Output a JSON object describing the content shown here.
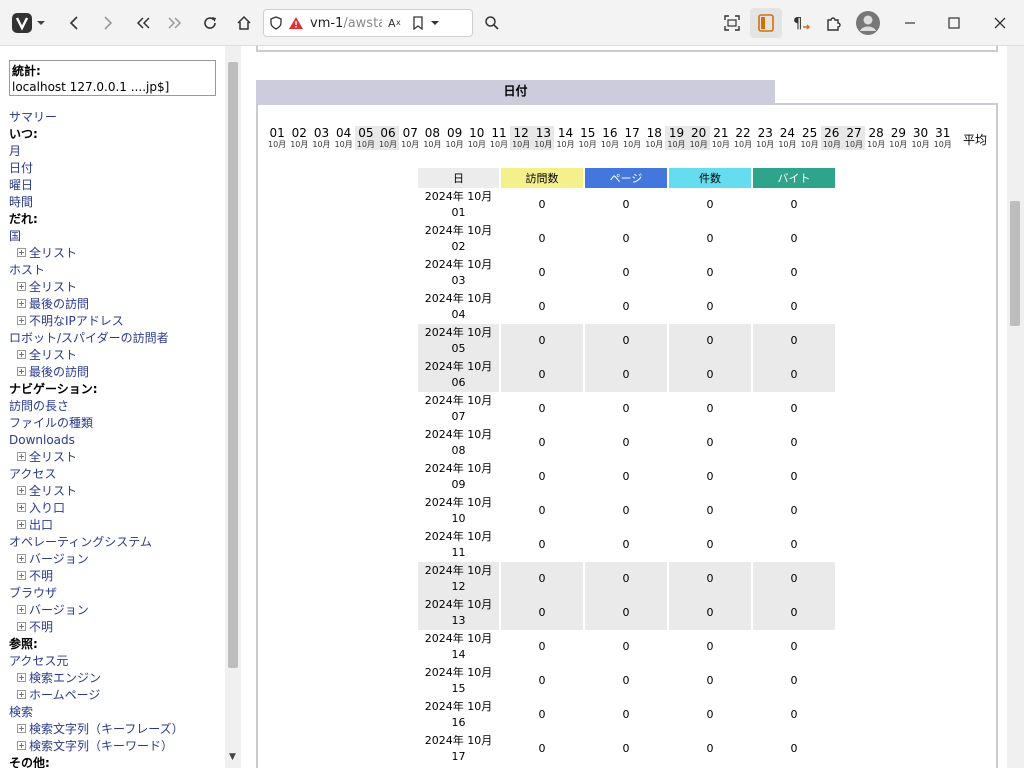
{
  "browser": {
    "url_host": "vm-1",
    "url_path": "/awstats/av"
  },
  "sidebar": {
    "stat_label": "統計:",
    "stat_value": "localhost 127.0.0.1 ....jp$]",
    "items": [
      {
        "type": "l",
        "label": "サマリー"
      },
      {
        "type": "h",
        "label": "いつ:"
      },
      {
        "type": "l",
        "label": "月"
      },
      {
        "type": "l",
        "label": "日付"
      },
      {
        "type": "l",
        "label": "曜日"
      },
      {
        "type": "l",
        "label": "時間"
      },
      {
        "type": "h",
        "label": "だれ:"
      },
      {
        "type": "l",
        "label": "国"
      },
      {
        "type": "s",
        "label": "全リスト"
      },
      {
        "type": "l",
        "label": "ホスト"
      },
      {
        "type": "s",
        "label": "全リスト"
      },
      {
        "type": "s",
        "label": "最後の訪問"
      },
      {
        "type": "s",
        "label": "不明なIPアドレス"
      },
      {
        "type": "l",
        "label": "ロボット/スパイダーの訪問者"
      },
      {
        "type": "s",
        "label": "全リスト"
      },
      {
        "type": "s",
        "label": "最後の訪問"
      },
      {
        "type": "h",
        "label": "ナビゲーション:"
      },
      {
        "type": "l",
        "label": "訪問の長さ"
      },
      {
        "type": "l",
        "label": "ファイルの種類"
      },
      {
        "type": "l",
        "label": "Downloads"
      },
      {
        "type": "s",
        "label": "全リスト"
      },
      {
        "type": "l",
        "label": "アクセス"
      },
      {
        "type": "s",
        "label": "全リスト"
      },
      {
        "type": "s",
        "label": "入り口"
      },
      {
        "type": "s",
        "label": "出口"
      },
      {
        "type": "l",
        "label": "オペレーティングシステム"
      },
      {
        "type": "s",
        "label": "バージョン"
      },
      {
        "type": "s",
        "label": "不明"
      },
      {
        "type": "l",
        "label": "ブラウザ"
      },
      {
        "type": "s",
        "label": "バージョン"
      },
      {
        "type": "s",
        "label": "不明"
      },
      {
        "type": "h",
        "label": "参照:"
      },
      {
        "type": "l",
        "label": "アクセス元"
      },
      {
        "type": "s",
        "label": "検索エンジン"
      },
      {
        "type": "s",
        "label": "ホームページ"
      },
      {
        "type": "l",
        "label": "検索"
      },
      {
        "type": "s",
        "label": "検索文字列（キーフレーズ）"
      },
      {
        "type": "s",
        "label": "検索文字列（キーワード）"
      },
      {
        "type": "h",
        "label": "その他:"
      }
    ]
  },
  "main": {
    "section_title": "日付",
    "month_label": "10月",
    "avg_label": "平均",
    "days": [
      "01",
      "02",
      "03",
      "04",
      "05",
      "06",
      "07",
      "08",
      "09",
      "10",
      "11",
      "12",
      "13",
      "14",
      "15",
      "16",
      "17",
      "18",
      "19",
      "20",
      "21",
      "22",
      "23",
      "24",
      "25",
      "26",
      "27",
      "28",
      "29",
      "30",
      "31"
    ],
    "weekend_days": [
      "05",
      "06",
      "12",
      "13",
      "19",
      "20",
      "26",
      "27"
    ],
    "table": {
      "headers": [
        "日",
        "訪問数",
        "ページ",
        "件数",
        "バイト"
      ],
      "header_colors": [
        "#ececec",
        "#f4f08c",
        "#4477dd",
        "#66ddee",
        "#2ea58a"
      ],
      "rows": [
        {
          "date": "2024年 10月",
          "day": "01",
          "weekend": false,
          "values": [
            "0",
            "0",
            "0",
            "0"
          ]
        },
        {
          "date": "2024年 10月",
          "day": "02",
          "weekend": false,
          "values": [
            "0",
            "0",
            "0",
            "0"
          ]
        },
        {
          "date": "2024年 10月",
          "day": "03",
          "weekend": false,
          "values": [
            "0",
            "0",
            "0",
            "0"
          ]
        },
        {
          "date": "2024年 10月",
          "day": "04",
          "weekend": false,
          "values": [
            "0",
            "0",
            "0",
            "0"
          ]
        },
        {
          "date": "2024年 10月",
          "day": "05",
          "weekend": true,
          "values": [
            "0",
            "0",
            "0",
            "0"
          ]
        },
        {
          "date": "2024年 10月",
          "day": "06",
          "weekend": true,
          "values": [
            "0",
            "0",
            "0",
            "0"
          ]
        },
        {
          "date": "2024年 10月",
          "day": "07",
          "weekend": false,
          "values": [
            "0",
            "0",
            "0",
            "0"
          ]
        },
        {
          "date": "2024年 10月",
          "day": "08",
          "weekend": false,
          "values": [
            "0",
            "0",
            "0",
            "0"
          ]
        },
        {
          "date": "2024年 10月",
          "day": "09",
          "weekend": false,
          "values": [
            "0",
            "0",
            "0",
            "0"
          ]
        },
        {
          "date": "2024年 10月",
          "day": "10",
          "weekend": false,
          "values": [
            "0",
            "0",
            "0",
            "0"
          ]
        },
        {
          "date": "2024年 10月",
          "day": "11",
          "weekend": false,
          "values": [
            "0",
            "0",
            "0",
            "0"
          ]
        },
        {
          "date": "2024年 10月",
          "day": "12",
          "weekend": true,
          "values": [
            "0",
            "0",
            "0",
            "0"
          ]
        },
        {
          "date": "2024年 10月",
          "day": "13",
          "weekend": true,
          "values": [
            "0",
            "0",
            "0",
            "0"
          ]
        },
        {
          "date": "2024年 10月",
          "day": "14",
          "weekend": false,
          "values": [
            "0",
            "0",
            "0",
            "0"
          ]
        },
        {
          "date": "2024年 10月",
          "day": "15",
          "weekend": false,
          "values": [
            "0",
            "0",
            "0",
            "0"
          ]
        },
        {
          "date": "2024年 10月",
          "day": "16",
          "weekend": false,
          "values": [
            "0",
            "0",
            "0",
            "0"
          ]
        },
        {
          "date": "2024年 10月",
          "day": "17",
          "weekend": false,
          "values": [
            "0",
            "0",
            "0",
            "0"
          ]
        }
      ]
    }
  }
}
